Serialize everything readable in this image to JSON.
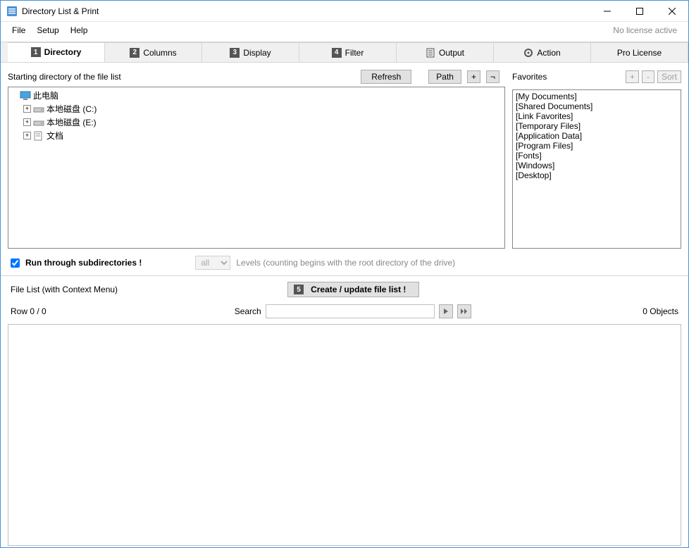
{
  "window": {
    "title": "Directory List & Print",
    "license_status": "No license active"
  },
  "menu": {
    "file": "File",
    "setup": "Setup",
    "help": "Help"
  },
  "tabs": [
    {
      "num": "1",
      "label": "Directory",
      "active": true
    },
    {
      "num": "2",
      "label": "Columns"
    },
    {
      "num": "3",
      "label": "Display"
    },
    {
      "num": "4",
      "label": "Filter"
    },
    {
      "icon": "doc",
      "label": "Output"
    },
    {
      "icon": "gear",
      "label": "Action"
    },
    {
      "label": "Pro License"
    }
  ],
  "directory": {
    "label": "Starting directory of the file list",
    "refresh": "Refresh",
    "path": "Path",
    "plus": "+",
    "undo": "¬",
    "tree": [
      {
        "level": 0,
        "expander": "",
        "icon": "pc",
        "label": "此电脑"
      },
      {
        "level": 1,
        "expander": "+",
        "icon": "drive",
        "label": "本地磁盘 (C:)"
      },
      {
        "level": 1,
        "expander": "+",
        "icon": "drive",
        "label": "本地磁盘 (E:)"
      },
      {
        "level": 1,
        "expander": "+",
        "icon": "doc",
        "label": "文档"
      }
    ]
  },
  "favorites": {
    "label": "Favorites",
    "add": "+",
    "remove": "-",
    "sort": "Sort",
    "items": [
      "[My Documents]",
      "[Shared Documents]",
      "[Link Favorites]",
      "[Temporary Files]",
      "[Application Data]",
      "[Program Files]",
      "[Fonts]",
      "[Windows]",
      "[Desktop]"
    ]
  },
  "subdirs": {
    "checkbox_checked": true,
    "label": "Run through subdirectories !",
    "levels_value": "all",
    "levels_hint": "Levels   (counting begins with the root directory of the drive)"
  },
  "filelist": {
    "context_label": "File List (with Context Menu)",
    "create_num": "5",
    "create_label": "Create / update file list !",
    "row_status": "Row 0 / 0",
    "search_label": "Search",
    "objects_status": "0 Objects"
  }
}
